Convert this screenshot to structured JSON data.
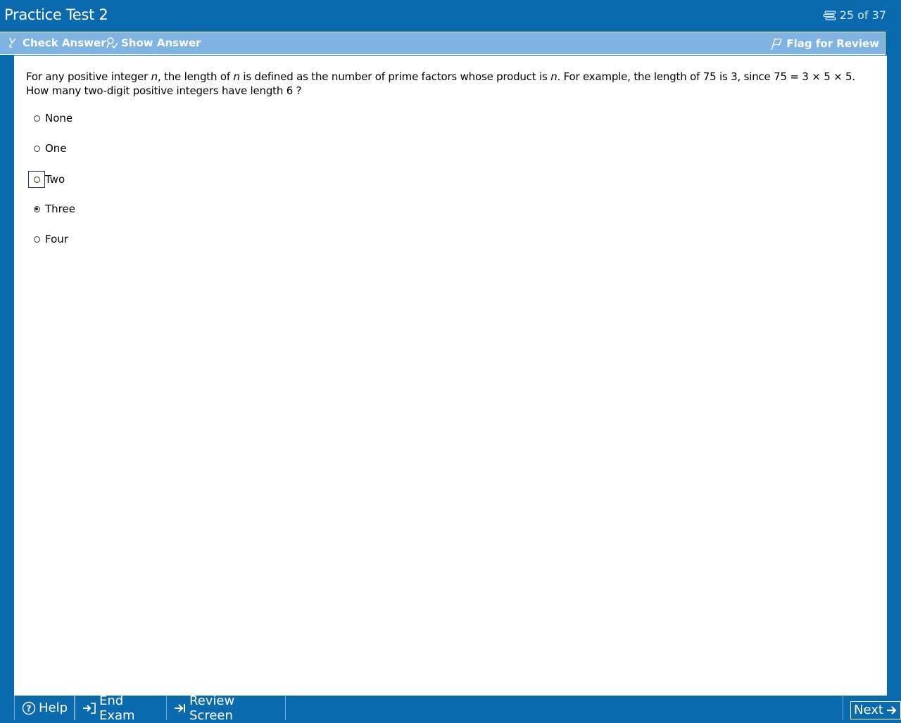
{
  "window": {
    "title": "Practice Test 2",
    "counter": "25 of 37"
  },
  "toolbar": {
    "check_answer": "Check Answer",
    "show_answer": "Show Answer",
    "flag_for_review": "Flag for Review"
  },
  "question": {
    "p1": "For any positive integer ",
    "var_n": "n",
    "p2": ", the length of ",
    "p3": " is defined as the number of prime factors whose product is ",
    "p4": ".  For example, the length of 75 is 3, since 75 = 3 × 5 × 5.  How many two-digit positive integers have length 6 ?"
  },
  "choices": [
    {
      "label": "None",
      "selected": false
    },
    {
      "label": "One",
      "selected": false
    },
    {
      "label": "Two",
      "selected": false,
      "focused": true
    },
    {
      "label": "Three",
      "selected": true
    },
    {
      "label": "Four",
      "selected": false
    }
  ],
  "bottom": {
    "help": "Help",
    "end_exam": "End Exam",
    "review_screen": "Review Screen",
    "next": "Next"
  },
  "icons": {
    "counter": "stack-icon",
    "check": "check-pen-icon",
    "show": "show-answer-icon",
    "flag": "flag-icon",
    "help": "help-circle-icon",
    "end": "exit-icon",
    "review": "review-icon",
    "next": "arrow-right-icon"
  },
  "colors": {
    "frame": "#0a6aad",
    "toolbar": "#7eb3e3",
    "content": "#ffffff"
  }
}
